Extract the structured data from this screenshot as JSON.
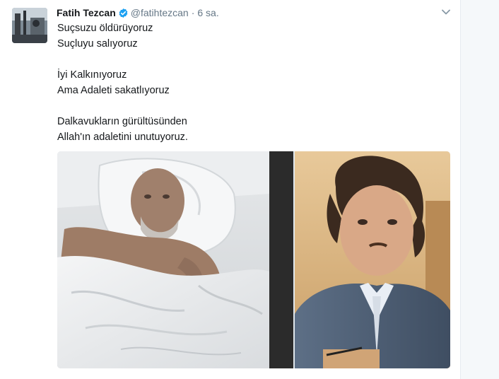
{
  "tweet": {
    "author": {
      "fullname": "Fatih Tezcan",
      "username": "@fatihtezcan",
      "verified": true
    },
    "separator": "·",
    "time": "6 sa.",
    "lines": [
      "Suçsuzu öldürüyoruz",
      "Suçluyu salıyoruz",
      "",
      "İyi Kalkınıyoruz",
      "Ama Adaleti sakatlıyoruz",
      "",
      "Dalkavukların gürültüsünden",
      "Allah'ın adaletini unutuyoruz."
    ],
    "icons": {
      "verified": "verified-badge-icon",
      "caret": "chevron-down-icon"
    },
    "colors": {
      "verified_blue": "#1da1f2",
      "text": "#14171a",
      "muted": "#657786"
    }
  }
}
